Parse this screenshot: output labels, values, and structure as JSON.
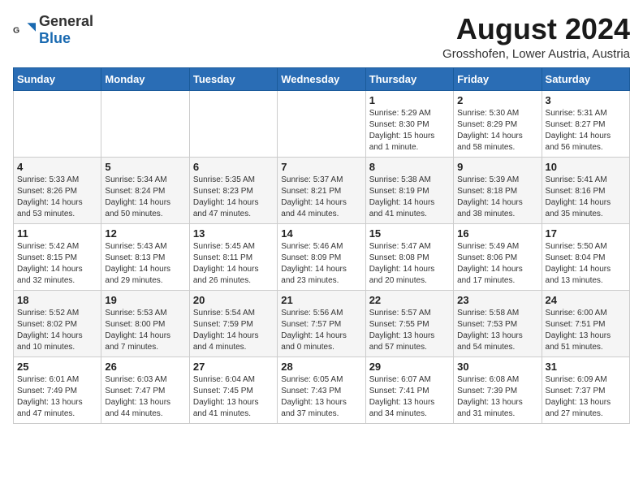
{
  "logo": {
    "general": "General",
    "blue": "Blue"
  },
  "header": {
    "title": "August 2024",
    "subtitle": "Grosshofen, Lower Austria, Austria"
  },
  "days_of_week": [
    "Sunday",
    "Monday",
    "Tuesday",
    "Wednesday",
    "Thursday",
    "Friday",
    "Saturday"
  ],
  "weeks": [
    [
      {
        "day": "",
        "info": ""
      },
      {
        "day": "",
        "info": ""
      },
      {
        "day": "",
        "info": ""
      },
      {
        "day": "",
        "info": ""
      },
      {
        "day": "1",
        "info": "Sunrise: 5:29 AM\nSunset: 8:30 PM\nDaylight: 15 hours\nand 1 minute."
      },
      {
        "day": "2",
        "info": "Sunrise: 5:30 AM\nSunset: 8:29 PM\nDaylight: 14 hours\nand 58 minutes."
      },
      {
        "day": "3",
        "info": "Sunrise: 5:31 AM\nSunset: 8:27 PM\nDaylight: 14 hours\nand 56 minutes."
      }
    ],
    [
      {
        "day": "4",
        "info": "Sunrise: 5:33 AM\nSunset: 8:26 PM\nDaylight: 14 hours\nand 53 minutes."
      },
      {
        "day": "5",
        "info": "Sunrise: 5:34 AM\nSunset: 8:24 PM\nDaylight: 14 hours\nand 50 minutes."
      },
      {
        "day": "6",
        "info": "Sunrise: 5:35 AM\nSunset: 8:23 PM\nDaylight: 14 hours\nand 47 minutes."
      },
      {
        "day": "7",
        "info": "Sunrise: 5:37 AM\nSunset: 8:21 PM\nDaylight: 14 hours\nand 44 minutes."
      },
      {
        "day": "8",
        "info": "Sunrise: 5:38 AM\nSunset: 8:19 PM\nDaylight: 14 hours\nand 41 minutes."
      },
      {
        "day": "9",
        "info": "Sunrise: 5:39 AM\nSunset: 8:18 PM\nDaylight: 14 hours\nand 38 minutes."
      },
      {
        "day": "10",
        "info": "Sunrise: 5:41 AM\nSunset: 8:16 PM\nDaylight: 14 hours\nand 35 minutes."
      }
    ],
    [
      {
        "day": "11",
        "info": "Sunrise: 5:42 AM\nSunset: 8:15 PM\nDaylight: 14 hours\nand 32 minutes."
      },
      {
        "day": "12",
        "info": "Sunrise: 5:43 AM\nSunset: 8:13 PM\nDaylight: 14 hours\nand 29 minutes."
      },
      {
        "day": "13",
        "info": "Sunrise: 5:45 AM\nSunset: 8:11 PM\nDaylight: 14 hours\nand 26 minutes."
      },
      {
        "day": "14",
        "info": "Sunrise: 5:46 AM\nSunset: 8:09 PM\nDaylight: 14 hours\nand 23 minutes."
      },
      {
        "day": "15",
        "info": "Sunrise: 5:47 AM\nSunset: 8:08 PM\nDaylight: 14 hours\nand 20 minutes."
      },
      {
        "day": "16",
        "info": "Sunrise: 5:49 AM\nSunset: 8:06 PM\nDaylight: 14 hours\nand 17 minutes."
      },
      {
        "day": "17",
        "info": "Sunrise: 5:50 AM\nSunset: 8:04 PM\nDaylight: 14 hours\nand 13 minutes."
      }
    ],
    [
      {
        "day": "18",
        "info": "Sunrise: 5:52 AM\nSunset: 8:02 PM\nDaylight: 14 hours\nand 10 minutes."
      },
      {
        "day": "19",
        "info": "Sunrise: 5:53 AM\nSunset: 8:00 PM\nDaylight: 14 hours\nand 7 minutes."
      },
      {
        "day": "20",
        "info": "Sunrise: 5:54 AM\nSunset: 7:59 PM\nDaylight: 14 hours\nand 4 minutes."
      },
      {
        "day": "21",
        "info": "Sunrise: 5:56 AM\nSunset: 7:57 PM\nDaylight: 14 hours\nand 0 minutes."
      },
      {
        "day": "22",
        "info": "Sunrise: 5:57 AM\nSunset: 7:55 PM\nDaylight: 13 hours\nand 57 minutes."
      },
      {
        "day": "23",
        "info": "Sunrise: 5:58 AM\nSunset: 7:53 PM\nDaylight: 13 hours\nand 54 minutes."
      },
      {
        "day": "24",
        "info": "Sunrise: 6:00 AM\nSunset: 7:51 PM\nDaylight: 13 hours\nand 51 minutes."
      }
    ],
    [
      {
        "day": "25",
        "info": "Sunrise: 6:01 AM\nSunset: 7:49 PM\nDaylight: 13 hours\nand 47 minutes."
      },
      {
        "day": "26",
        "info": "Sunrise: 6:03 AM\nSunset: 7:47 PM\nDaylight: 13 hours\nand 44 minutes."
      },
      {
        "day": "27",
        "info": "Sunrise: 6:04 AM\nSunset: 7:45 PM\nDaylight: 13 hours\nand 41 minutes."
      },
      {
        "day": "28",
        "info": "Sunrise: 6:05 AM\nSunset: 7:43 PM\nDaylight: 13 hours\nand 37 minutes."
      },
      {
        "day": "29",
        "info": "Sunrise: 6:07 AM\nSunset: 7:41 PM\nDaylight: 13 hours\nand 34 minutes."
      },
      {
        "day": "30",
        "info": "Sunrise: 6:08 AM\nSunset: 7:39 PM\nDaylight: 13 hours\nand 31 minutes."
      },
      {
        "day": "31",
        "info": "Sunrise: 6:09 AM\nSunset: 7:37 PM\nDaylight: 13 hours\nand 27 minutes."
      }
    ]
  ]
}
